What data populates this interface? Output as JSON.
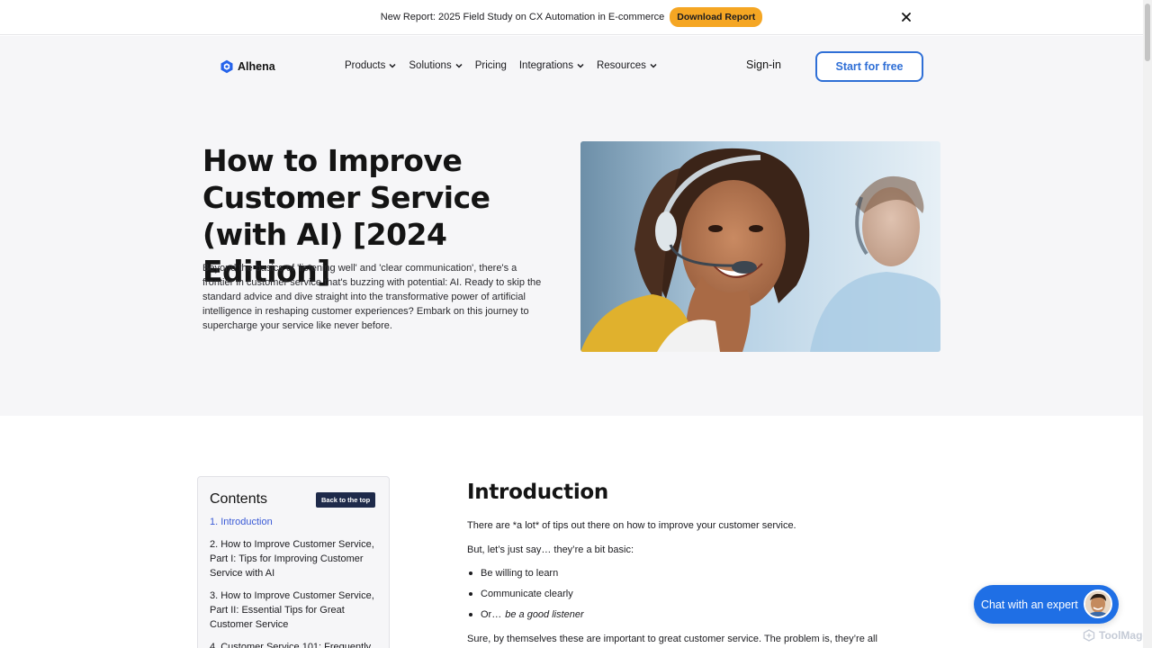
{
  "announcement": {
    "message": "New Report: 2025 Field Study on CX Automation in E-commerce",
    "button_label": "Download Report",
    "close_icon": "close-icon"
  },
  "nav": {
    "logo_text": "Alhena",
    "links": [
      {
        "label": "Products",
        "has_dropdown": true
      },
      {
        "label": "Solutions",
        "has_dropdown": true
      },
      {
        "label": "Pricing",
        "has_dropdown": false
      },
      {
        "label": "Integrations",
        "has_dropdown": true
      },
      {
        "label": "Resources",
        "has_dropdown": true
      }
    ],
    "signin_label": "Sign-in",
    "cta_label": "Start for free"
  },
  "hero": {
    "title": "How to Improve Customer Service (with AI) [2024 Edition]",
    "description": "Beyond the basics of 'listening well' and 'clear communication', there's a frontier in customer service that's buzzing with potential: AI. Ready to skip the standard advice and dive straight into the transformative power of artificial intelligence in reshaping customer experiences? Embark on this journey to supercharge your service like never before."
  },
  "toc": {
    "title": "Contents",
    "back_label": "Back to the top",
    "items": [
      "1. Introduction",
      "2. How to Improve Customer Service, Part I: Tips for Improving Customer Service with AI",
      "3. How to Improve Customer Service, Part II: Essential Tips for Great Customer Service",
      "4. Customer Service 101: Frequently"
    ]
  },
  "article": {
    "heading": "Introduction",
    "p1": "There are *a lot* of tips out there on how to improve your customer service.",
    "p2": "But, let’s just say… they’re a bit basic:",
    "bullets": [
      "Be willing to learn",
      "Communicate clearly"
    ],
    "bullet3_prefix": "Or…",
    "bullet3_emphasis": "be a good listener",
    "p3": "Sure, by themselves these are important to great customer service. The problem is, they’re all"
  },
  "chat": {
    "label": "Chat with an expert"
  },
  "watermark": {
    "text": "ToolMage"
  },
  "colors": {
    "accent": "#2f6fd6",
    "chat": "#1f6fe5",
    "download_button": "#f5a623",
    "toc_back": "#1e2a4a",
    "toc_active": "#3b5bd6"
  }
}
